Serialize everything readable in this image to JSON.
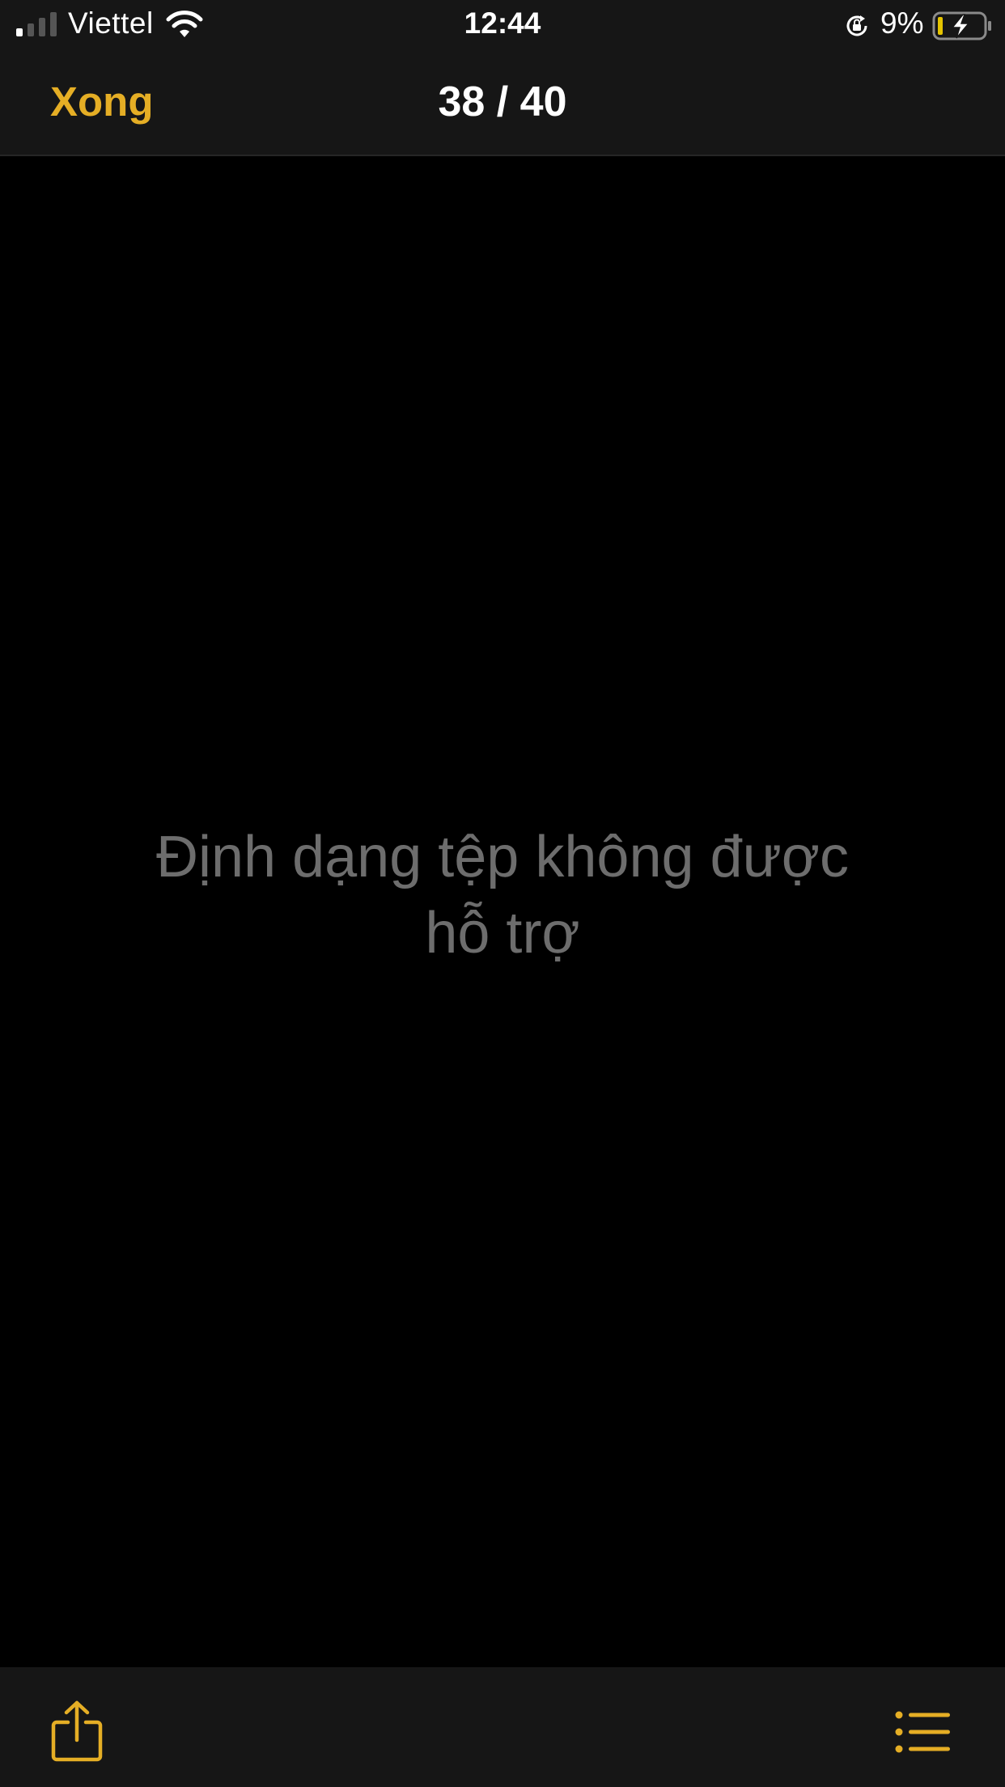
{
  "status_bar": {
    "carrier": "Viettel",
    "time": "12:44",
    "battery_percent": "9%",
    "battery_level": 0.09,
    "charging": true,
    "icons": [
      "signal-icon",
      "wifi-icon",
      "orientation-lock-icon",
      "battery-charging-icon"
    ]
  },
  "nav_bar": {
    "done_label": "Xong",
    "page_counter": "38 / 40"
  },
  "content": {
    "message_line1": "Định dạng tệp không được",
    "message_line2": "hỗ trợ"
  },
  "toolbar": {
    "share_icon": "share-icon",
    "list_icon": "list-icon"
  },
  "colors": {
    "accent": "#e5ae25",
    "background": "#000000",
    "bar_background": "#161616",
    "message_text": "#6d6d6d"
  }
}
